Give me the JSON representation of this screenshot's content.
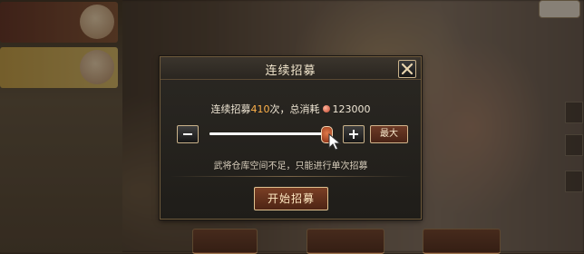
{
  "dialog": {
    "title": "连续招募",
    "summary": {
      "prefix": "连续招募",
      "count": "410",
      "mid": "次，总消耗",
      "cost": "123000"
    },
    "slider": {
      "value_fraction": 0.97
    },
    "max_label": "最大",
    "hint": "武将仓库空间不足，只能进行单次招募",
    "start_label": "开始招募"
  },
  "colors": {
    "accent_count": "#ffb24a",
    "panel_bg": "#1f1d19",
    "border_gold": "#c9b28a"
  },
  "icons": {
    "close": "close-icon",
    "minus": "minus-icon",
    "plus": "plus-icon",
    "coin": "coin-icon",
    "cursor": "cursor-icon"
  }
}
